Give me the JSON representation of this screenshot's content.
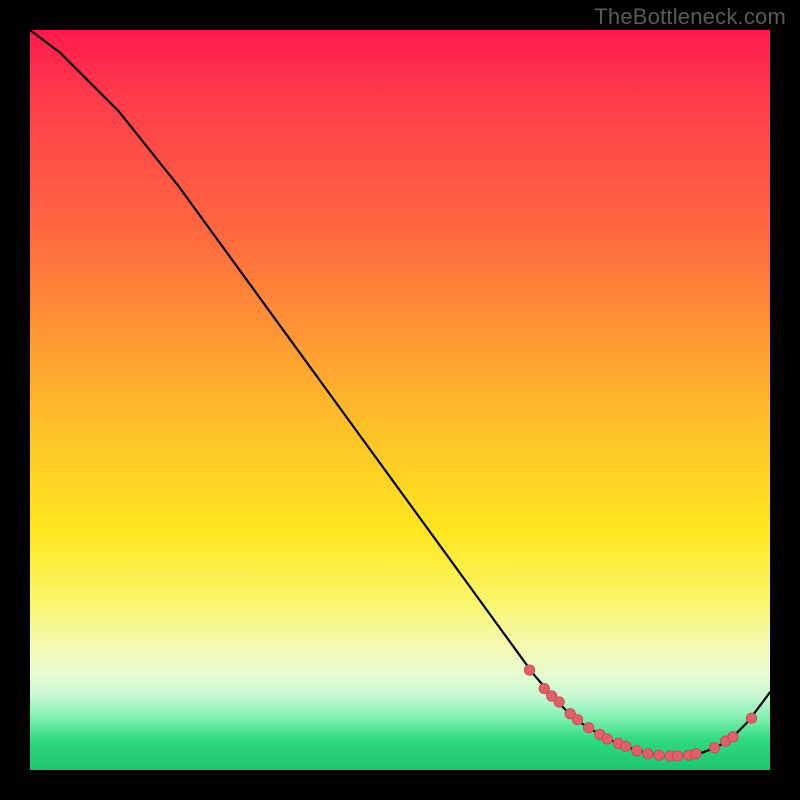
{
  "watermark": "TheBottleneck.com",
  "colors": {
    "curve_stroke": "#000000",
    "dot_fill": "#e06067",
    "dot_stroke": "#c24a52",
    "gradient_stops": [
      {
        "pos": 0.0,
        "hex": "#ff1a4d"
      },
      {
        "pos": 0.1,
        "hex": "#ff3e4a"
      },
      {
        "pos": 0.28,
        "hex": "#ff6a3f"
      },
      {
        "pos": 0.42,
        "hex": "#ff9a33"
      },
      {
        "pos": 0.55,
        "hex": "#ffc528"
      },
      {
        "pos": 0.68,
        "hex": "#ffe71f"
      },
      {
        "pos": 0.77,
        "hex": "#fbf66a"
      },
      {
        "pos": 0.83,
        "hex": "#f5f9b0"
      },
      {
        "pos": 0.87,
        "hex": "#e8fbd0"
      },
      {
        "pos": 0.9,
        "hex": "#c7f9d4"
      },
      {
        "pos": 0.93,
        "hex": "#7ef0b0"
      },
      {
        "pos": 0.96,
        "hex": "#2fd97f"
      },
      {
        "pos": 1.0,
        "hex": "#1fc46f"
      }
    ]
  },
  "chart_data": {
    "type": "line",
    "title": "",
    "xlabel": "",
    "ylabel": "",
    "xlim": [
      0,
      100
    ],
    "ylim": [
      0,
      100
    ],
    "series": [
      {
        "name": "bottleneck-curve",
        "x": [
          0,
          4,
          8,
          12,
          16,
          20,
          24,
          28,
          32,
          36,
          40,
          44,
          48,
          52,
          56,
          60,
          64,
          68,
          71,
          73,
          75,
          77,
          79,
          81,
          83,
          85,
          87,
          89,
          91,
          93,
          95,
          97,
          100
        ],
        "y": [
          100,
          97,
          93,
          89,
          84,
          79,
          73.5,
          68,
          62.5,
          57,
          51.5,
          46,
          40.5,
          35,
          29.5,
          24,
          18.5,
          13,
          9.5,
          7.5,
          6.0,
          4.8,
          3.8,
          3.0,
          2.4,
          2.0,
          1.9,
          2.0,
          2.4,
          3.2,
          4.5,
          6.5,
          10.5
        ]
      }
    ],
    "dots": {
      "name": "highlight-dots",
      "points": [
        {
          "x": 67.5,
          "y": 13.5
        },
        {
          "x": 69.5,
          "y": 11.0
        },
        {
          "x": 70.5,
          "y": 10.0
        },
        {
          "x": 71.5,
          "y": 9.2
        },
        {
          "x": 73.0,
          "y": 7.6
        },
        {
          "x": 74.0,
          "y": 6.8
        },
        {
          "x": 75.5,
          "y": 5.7
        },
        {
          "x": 77.0,
          "y": 4.8
        },
        {
          "x": 78.0,
          "y": 4.2
        },
        {
          "x": 79.5,
          "y": 3.6
        },
        {
          "x": 80.5,
          "y": 3.2
        },
        {
          "x": 82.0,
          "y": 2.6
        },
        {
          "x": 83.5,
          "y": 2.2
        },
        {
          "x": 85.0,
          "y": 2.0
        },
        {
          "x": 86.5,
          "y": 1.9
        },
        {
          "x": 87.5,
          "y": 1.9
        },
        {
          "x": 89.0,
          "y": 2.0
        },
        {
          "x": 90.0,
          "y": 2.2
        },
        {
          "x": 92.5,
          "y": 3.0
        },
        {
          "x": 94.0,
          "y": 3.9
        },
        {
          "x": 95.0,
          "y": 4.5
        },
        {
          "x": 97.5,
          "y": 7.0
        }
      ]
    }
  }
}
